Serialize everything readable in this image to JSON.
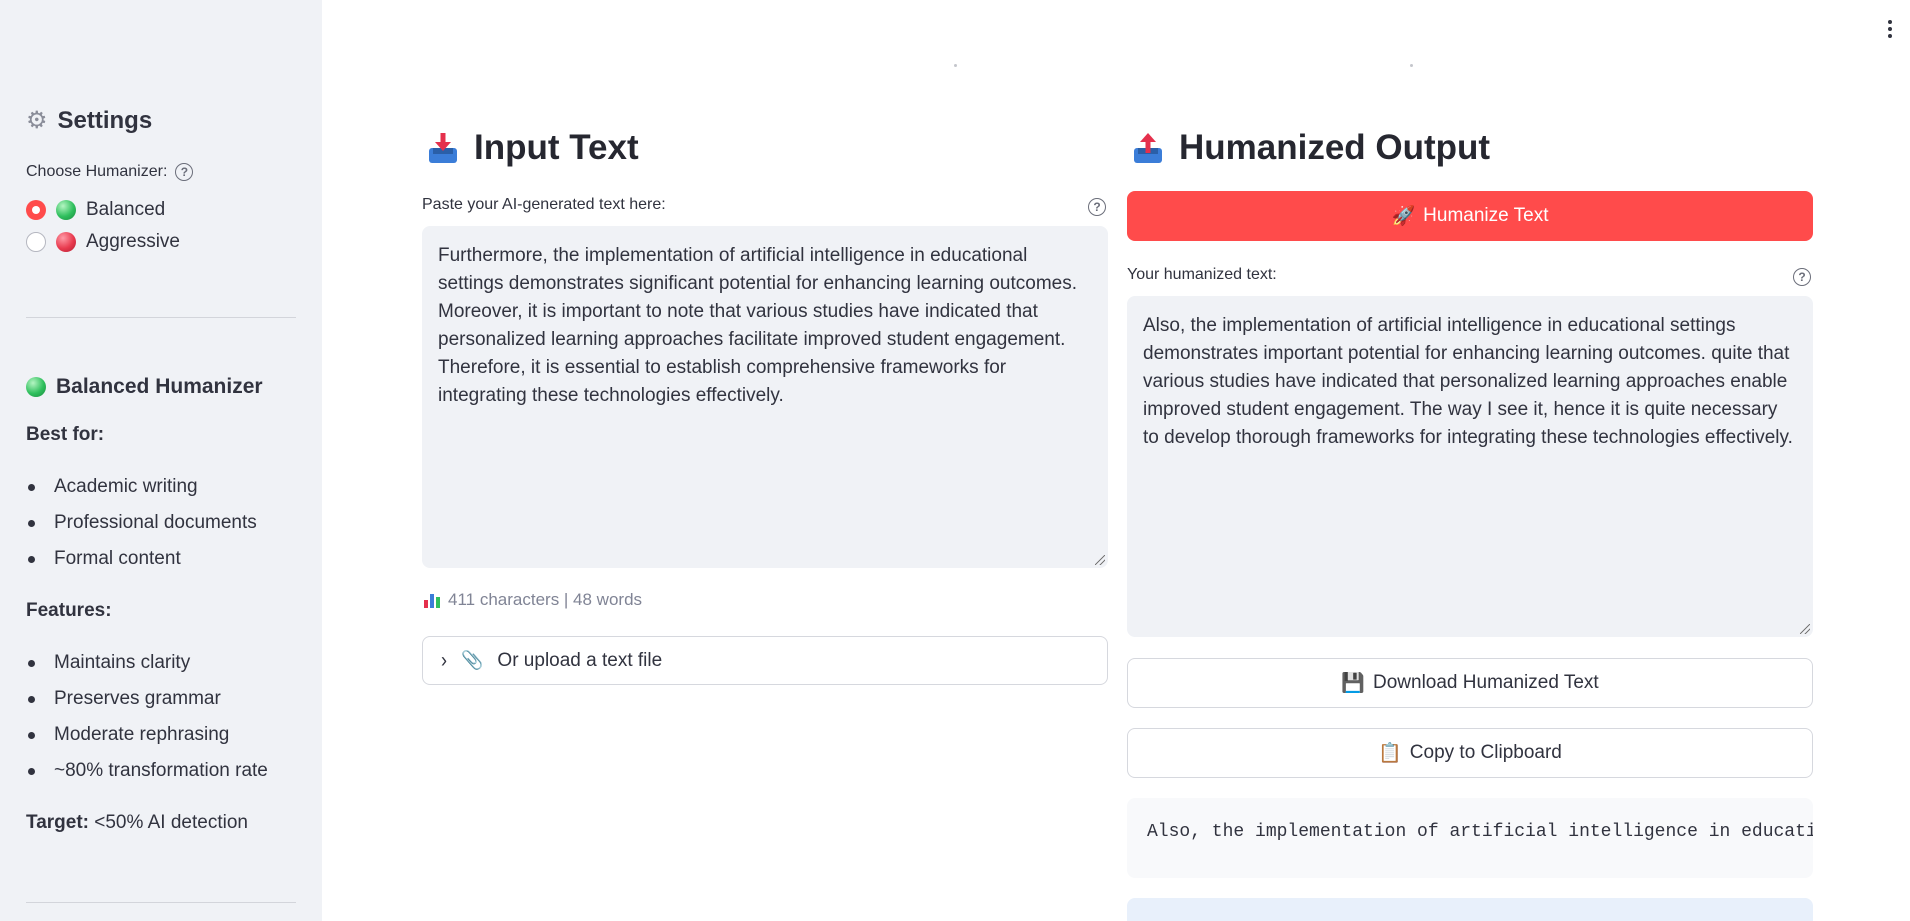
{
  "sidebar": {
    "settings_icon": "gear-icon",
    "settings_title": "Settings",
    "choose_label": "Choose Humanizer:",
    "options": [
      {
        "label": "Balanced",
        "selected": true,
        "color": "#2fbf5d"
      },
      {
        "label": "Aggressive",
        "selected": false,
        "color": "#e83a4e"
      }
    ],
    "info": {
      "heading": "Balanced Humanizer",
      "best_for_label": "Best for:",
      "best_for": [
        "Academic writing",
        "Professional documents",
        "Formal content"
      ],
      "features_label": "Features:",
      "features": [
        "Maintains clarity",
        "Preserves grammar",
        "Moderate rephrasing",
        "~80% transformation rate"
      ],
      "target_label": "Target:",
      "target_value": " <50% AI detection"
    }
  },
  "input": {
    "title": "Input Text",
    "icon": "inbox-tray-icon",
    "field_label": "Paste your AI-generated text here:",
    "text": "Furthermore, the implementation of artificial intelligence in educational settings demonstrates significant potential for enhancing learning outcomes. Moreover, it is important to note that various studies have indicated that personalized learning approaches facilitate improved student engagement. Therefore, it is essential to establish comprehensive frameworks for integrating these technologies effectively.",
    "stats": "411 characters | 48 words",
    "upload_label": "Or upload a text file"
  },
  "output": {
    "title": "Humanized Output",
    "icon": "outbox-tray-icon",
    "humanize_button": "Humanize Text",
    "field_label": "Your humanized text:",
    "text": "Also, the implementation of artificial intelligence in educational settings demonstrates important potential for enhancing learning outcomes.  quite that various studies have indicated that personalized learning approaches enable improved student engagement. The way I see it, hence it is quite necessary to develop thorough frameworks for integrating these technologies effectively.",
    "download_button": "Download Humanized Text",
    "copy_button": "Copy to Clipboard",
    "code_preview": "Also, the implementation of artificial intelligence in educational settings demonstrates important potential for enhancing learning outcomes."
  },
  "colors": {
    "primary": "#ff4b4b",
    "sidebar_bg": "#f0f2f6",
    "text": "#31333f"
  }
}
